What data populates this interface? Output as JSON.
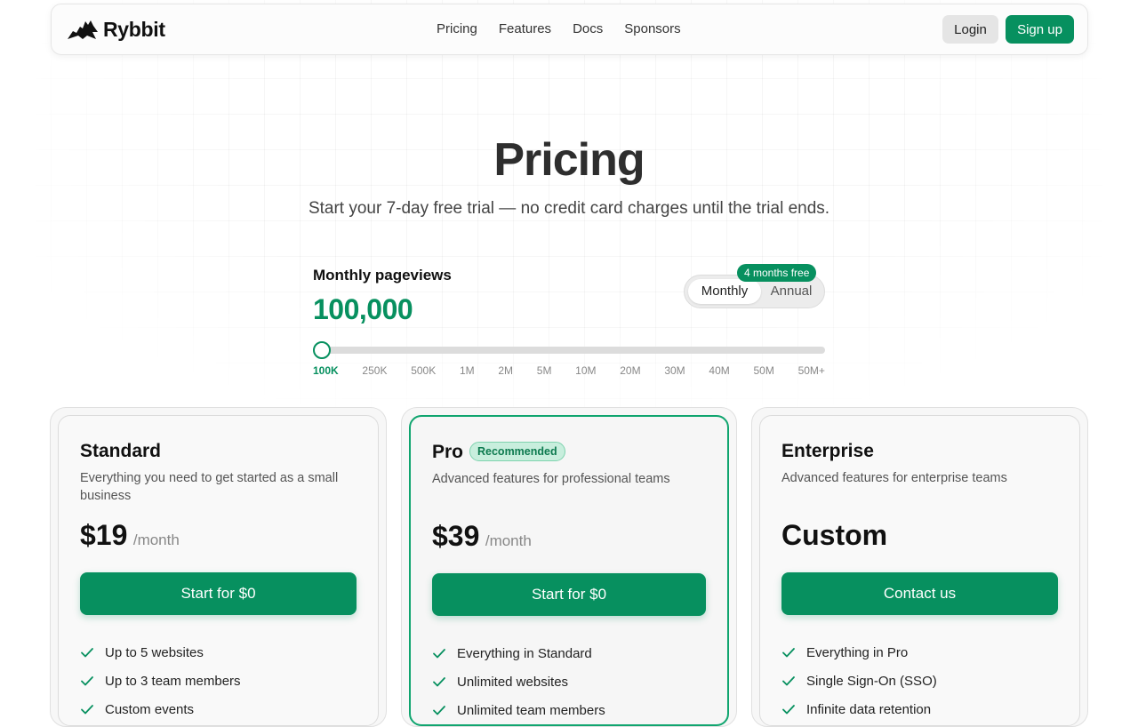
{
  "nav": {
    "brand": "Rybbit",
    "links": [
      "Pricing",
      "Features",
      "Docs",
      "Sponsors"
    ],
    "login_label": "Login",
    "signup_label": "Sign up"
  },
  "hero": {
    "title": "Pricing",
    "subtitle": "Start your 7-day free trial — no credit card charges until the trial ends."
  },
  "pageviews": {
    "label": "Monthly pageviews",
    "value": "100,000",
    "ticks": [
      "100K",
      "250K",
      "500K",
      "1M",
      "2M",
      "5M",
      "10M",
      "20M",
      "30M",
      "40M",
      "50M",
      "50M+"
    ],
    "selected_index": 0
  },
  "billing": {
    "monthly_label": "Monthly",
    "annual_label": "Annual",
    "promo": "4 months free",
    "selected": "Monthly"
  },
  "plans": [
    {
      "name": "Standard",
      "description": "Everything you need to get started as a small business",
      "price": "$19",
      "period": "/month",
      "button": "Start for $0",
      "features": [
        "Up to 5 websites",
        "Up to 3 team members",
        "Custom events"
      ]
    },
    {
      "name": "Pro",
      "badge": "Recommended",
      "description": "Advanced features for professional teams",
      "price": "$39",
      "period": "/month",
      "button": "Start for $0",
      "features": [
        "Everything in Standard",
        "Unlimited websites",
        "Unlimited team members"
      ]
    },
    {
      "name": "Enterprise",
      "description": "Advanced features for enterprise teams",
      "price": "Custom",
      "button": "Contact us",
      "features": [
        "Everything in Pro",
        "Single Sign-On (SSO)",
        "Infinite data retention"
      ]
    }
  ],
  "colors": {
    "accent": "#07905f",
    "badge_bg": "#c8eedd"
  }
}
